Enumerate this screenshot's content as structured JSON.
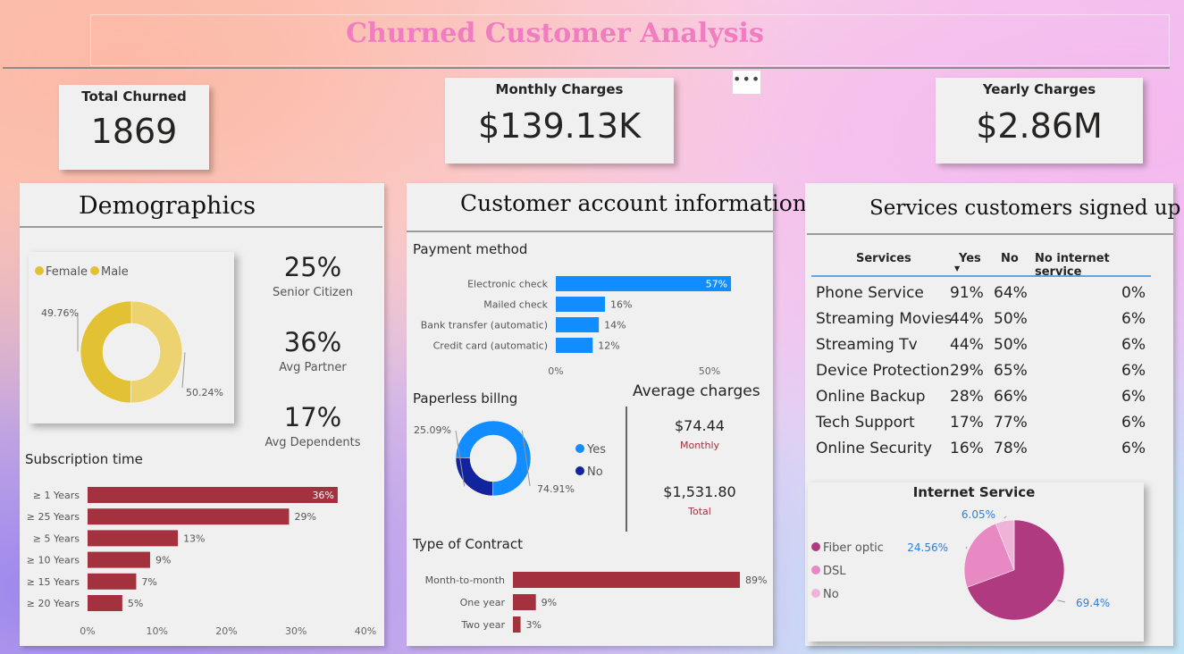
{
  "title": "Churned Customer Analysis",
  "more_icon": "more-options-icon",
  "kpis": {
    "total_churned": {
      "label": "Total Churned",
      "value": "1869"
    },
    "monthly_charges": {
      "label": "Monthly Charges",
      "value": "$139.13K"
    },
    "yearly_charges": {
      "label": "Yearly Charges",
      "value": "$2.86M"
    }
  },
  "demographics": {
    "title": "Demographics",
    "stats": [
      {
        "value": "25%",
        "label": "Senior Citizen"
      },
      {
        "value": "36%",
        "label": "Avg Partner"
      },
      {
        "value": "17%",
        "label": "Avg Dependents"
      }
    ]
  },
  "account": {
    "title": "Customer account information",
    "payment_title": "Payment method",
    "paperless_title": "Paperless billng",
    "contract_title": "Type of Contract",
    "avg_title": "Average charges",
    "avg_monthly": {
      "value": "$74.44",
      "label": "Monthly"
    },
    "avg_total": {
      "value": "$1,531.80",
      "label": "Total"
    }
  },
  "services": {
    "title": "Services customers signed up for",
    "headers": [
      "Services",
      "Yes",
      "No",
      "No internet service"
    ],
    "rows": [
      {
        "service": "Phone Service",
        "yes": "91%",
        "no": "64%",
        "nis": "0%"
      },
      {
        "service": "Streaming Movies",
        "yes": "44%",
        "no": "50%",
        "nis": "6%"
      },
      {
        "service": "Streaming Tv",
        "yes": "44%",
        "no": "50%",
        "nis": "6%"
      },
      {
        "service": "Device Protection",
        "yes": "29%",
        "no": "65%",
        "nis": "6%"
      },
      {
        "service": "Online Backup",
        "yes": "28%",
        "no": "66%",
        "nis": "6%"
      },
      {
        "service": "Tech Support",
        "yes": "17%",
        "no": "77%",
        "nis": "6%"
      },
      {
        "service": "Online Security",
        "yes": "16%",
        "no": "78%",
        "nis": "6%"
      }
    ]
  },
  "colors": {
    "gold_dark": "#e2c134",
    "gold_light": "#ecd36f",
    "maroon": "#a3323e",
    "blue": "#118dff",
    "navy": "#12239e",
    "fiber": "#b03a80",
    "dsl": "#e889c3",
    "no": "#f0b3d8"
  },
  "chart_data": [
    {
      "id": "gender",
      "type": "pie",
      "legend": [
        "Female",
        "Male"
      ],
      "slices": [
        {
          "name": "Female",
          "value": 50.24,
          "label": "50.24%",
          "color": "#ecd36f"
        },
        {
          "name": "Male",
          "value": 49.76,
          "label": "49.76%",
          "color": "#e2c134"
        }
      ],
      "legend_position": "top-left"
    },
    {
      "id": "subscription",
      "type": "bar",
      "title": "Subscription time",
      "categories": [
        "≥ 1 Years",
        "≥ 25 Years",
        "≥ 5 Years",
        "≥ 10 Years",
        "≥ 15 Years",
        "≥ 20 Years"
      ],
      "values": [
        36,
        29,
        13,
        9,
        7,
        5
      ],
      "data_labels": [
        "36%",
        "29%",
        "13%",
        "9%",
        "7%",
        "5%"
      ],
      "xlim": [
        0,
        40
      ],
      "xticks": [
        "0%",
        "10%",
        "20%",
        "30%",
        "40%"
      ],
      "color": "#a3323e"
    },
    {
      "id": "payment",
      "type": "bar",
      "title": "Payment method",
      "categories": [
        "Electronic check",
        "Mailed check",
        "Bank transfer (automatic)",
        "Credit card (automatic)"
      ],
      "values": [
        57,
        16,
        14,
        12
      ],
      "data_labels": [
        "57%",
        "16%",
        "14%",
        "12%"
      ],
      "xlim": [
        0,
        50
      ],
      "xticks": [
        "0%",
        "50%"
      ],
      "color": "#118dff"
    },
    {
      "id": "paperless",
      "type": "pie",
      "title": "Paperless billng",
      "legend": [
        "Yes",
        "No"
      ],
      "slices": [
        {
          "name": "Yes",
          "value": 74.91,
          "label": "74.91%",
          "color": "#118dff"
        },
        {
          "name": "No",
          "value": 25.09,
          "label": "25.09%",
          "color": "#12239e"
        }
      ],
      "legend_position": "right"
    },
    {
      "id": "contract",
      "type": "bar",
      "title": "Type of Contract",
      "categories": [
        "Month-to-month",
        "One year",
        "Two year"
      ],
      "values": [
        89,
        9,
        3
      ],
      "data_labels": [
        "89%",
        "9%",
        "3%"
      ],
      "xlim": [
        0,
        89
      ],
      "color": "#a3323e"
    },
    {
      "id": "internet",
      "type": "pie",
      "title": "Internet Service",
      "legend": [
        "Fiber optic",
        "DSL",
        "No"
      ],
      "slices": [
        {
          "name": "Fiber optic",
          "value": 69.4,
          "label": "69.4%",
          "color": "#b03a80"
        },
        {
          "name": "DSL",
          "value": 24.56,
          "label": "24.56%",
          "color": "#e889c3"
        },
        {
          "name": "No",
          "value": 6.05,
          "label": "6.05%",
          "color": "#f0b3d8"
        }
      ],
      "legend_position": "left"
    }
  ]
}
